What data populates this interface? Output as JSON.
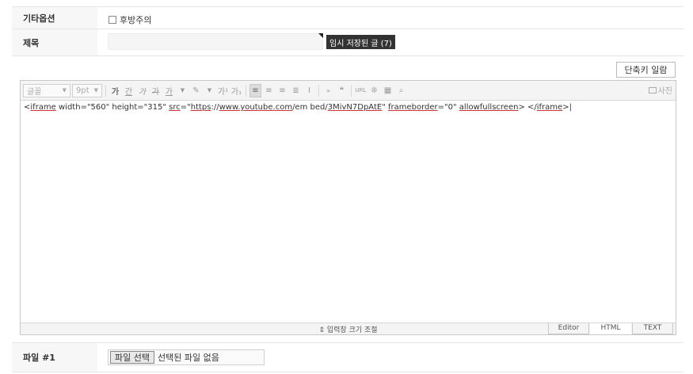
{
  "options": {
    "label": "기타옵션",
    "spoiler_label": "후방주의"
  },
  "subject": {
    "label": "제목",
    "value": "",
    "draft_button": "임시 저장된 글 (7)"
  },
  "shortcut_button": "단축키 일람",
  "toolbar": {
    "font_family": "글꼴",
    "font_size": "9pt",
    "buttons": [
      "가",
      "간",
      "가",
      "가",
      "가",
      "가",
      "가",
      "가"
    ],
    "superscript": "가¹",
    "subscript": "가₁",
    "photo_label": "사진",
    "url_label": "URL",
    "quote_label": "❝"
  },
  "editor": {
    "content_parts": [
      "<",
      "iframe",
      " width=\"560\" height=\"315\" ",
      "src",
      "=\"",
      "https",
      "://",
      "www.youtube.com",
      "/em bed/",
      "3MivN7DpAtE",
      "\" ",
      "frameborder",
      "=\"0\" ",
      "allowfullscreen",
      "> </",
      "iframe",
      ">|"
    ],
    "resize_label": "⇕ 입력창 크기 조절",
    "mode_tabs": [
      "Editor",
      "HTML",
      "TEXT"
    ],
    "active_mode": "HTML"
  },
  "file": {
    "label": "파일 #1",
    "choose_button": "파일 선택",
    "status": "선택된 파일 없음"
  },
  "colors": {
    "label_bg": "#f7f7f7",
    "toolbar_bg": "#f4f4f4",
    "draft_bg": "#333333"
  }
}
